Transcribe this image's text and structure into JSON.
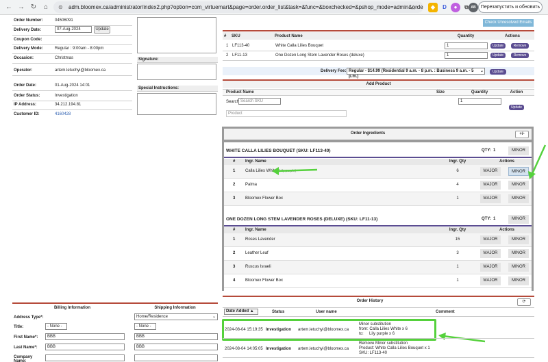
{
  "browser": {
    "url": "adm.bloomex.ca/administrator/index2.php?option=com_virtuemart&page=order.order_list&task=&func=&boxchecked=&pshop_mode=admin&order_id...",
    "relaunch_label": "Перезапустить и обновить",
    "profile_initial": "AB"
  },
  "order": {
    "fields": [
      {
        "label": "Order Number:",
        "value": "04506091"
      },
      {
        "label": "Delivery Date:",
        "value": ""
      },
      {
        "label": "Coupon Code:",
        "value": ""
      },
      {
        "label": "Delivery Mode:",
        "value": "Regular : 9:00am - 8:00pm"
      },
      {
        "label": "Occasion:",
        "value": "Christmas"
      },
      {
        "label": "Operator:",
        "value": "artem.letuchyi@bloomex.ca"
      },
      {
        "label": "Order Date:",
        "value": "01-Aug-2024 14:01"
      },
      {
        "label": "Order Status:",
        "value": "Investigation"
      },
      {
        "label": "IP Address:",
        "value": "34.212.194.81"
      },
      {
        "label": "Customer ID:",
        "value": "4160428"
      }
    ],
    "delivery_date_input": "07-Aug-2024",
    "update_label": "Update",
    "signature_label": "Signature:",
    "special_instructions_label": "Special Instructions:"
  },
  "unresolved_btn": "Check Unresolved Emails",
  "items": {
    "headers": [
      "#",
      "SKU",
      "Product Name",
      "Quantity",
      "Actions"
    ],
    "rows": [
      {
        "n": "1",
        "sku": "LF113-40",
        "name": "White Calla Lilies Bouquet",
        "qty": "1"
      },
      {
        "n": "2",
        "sku": "LF11-13",
        "name": "One Dozen Long Stem Lavender Roses (deluxe)",
        "qty": "1"
      }
    ],
    "update_label": "Update",
    "remove_label": "Remove"
  },
  "delivery_fee": {
    "label": "Delivery Fee:",
    "value": "Regular - $14.99 (Residential 9 a.m. - 8 p.m. : Business 9 a.m. - 5 p.m.)",
    "update_label": "Update"
  },
  "add_product": {
    "title": "Add Product",
    "headers": [
      "Product Name",
      "Size",
      "Quantity",
      "Action"
    ],
    "search_label": "Search:",
    "search_placeholder": "Search SKU",
    "product_placeholder": "Product",
    "qty": "1",
    "update_label": "Update"
  },
  "ingredients": {
    "title": "Order Ingredients",
    "toggle": "+/-",
    "col_headers": [
      "#",
      "Ingr. Name",
      "Ingr. Qty",
      "Actions"
    ],
    "major_label": "MAJOR",
    "minor_label": "MINOR",
    "blocks": [
      {
        "title": "WHITE CALLA LILIES BOUQUET (SKU: LF113-40)",
        "qty_label": "QTY:",
        "qty": "1",
        "rows": [
          {
            "n": "1",
            "name": "Calla Lilies White",
            "note": "(Lily purple)",
            "qty": "6"
          },
          {
            "n": "2",
            "name": "Palma",
            "note": "",
            "qty": "4"
          },
          {
            "n": "3",
            "name": "Bloomex Flower Box",
            "note": "",
            "qty": "1"
          }
        ]
      },
      {
        "title": "ONE DOZEN LONG STEM LAVENDER ROSES (DELUXE) (SKU: LF11-13)",
        "qty_label": "QTY:",
        "qty": "1",
        "rows": [
          {
            "n": "1",
            "name": "Roses Lavender",
            "note": "",
            "qty": "15"
          },
          {
            "n": "2",
            "name": "Leather Leaf",
            "note": "",
            "qty": "3"
          },
          {
            "n": "3",
            "name": "Ruscus Israeli",
            "note": "",
            "qty": "1"
          },
          {
            "n": "4",
            "name": "Bloomex Flower Box",
            "note": "",
            "qty": "1"
          }
        ]
      }
    ]
  },
  "billing": {
    "billing_title": "Billing Information",
    "shipping_title": "Shipping Information",
    "address_type_label": "Address Type*:",
    "address_type_value": "Home/Residence",
    "title_label": "Title:",
    "title_value": "- None -",
    "first_name_label": "First Name*:",
    "first_name": "BBB",
    "last_name_label": "Last Name*:",
    "last_name": "BBB",
    "company_label": "Company Name:"
  },
  "history": {
    "title": "Order History",
    "headers": [
      "Date Added ▲",
      "Status",
      "User name",
      "Comment"
    ],
    "rows": [
      {
        "date": "2024-08-04 15:19:35",
        "status": "Investigation",
        "user": "artem.letuchyi@bloomex.ca",
        "comment": [
          "Minor substitution",
          "from: Calla Lilies White x 6",
          "to:     Lily purple x 6"
        ]
      },
      {
        "date": "2024-08-04 14:05:05",
        "status": "Investigation",
        "user": "artem.letuchyi@bloomex.ca",
        "comment": [
          "Remove Minor substitution",
          "Product: White Calla Lilies Bouquet x 1",
          "SKU: LF113-40"
        ]
      }
    ]
  },
  "colors": {
    "accent_purple": "#5b4d91",
    "highlight_green": "#55d13c",
    "header_red": "#b54a3a"
  }
}
